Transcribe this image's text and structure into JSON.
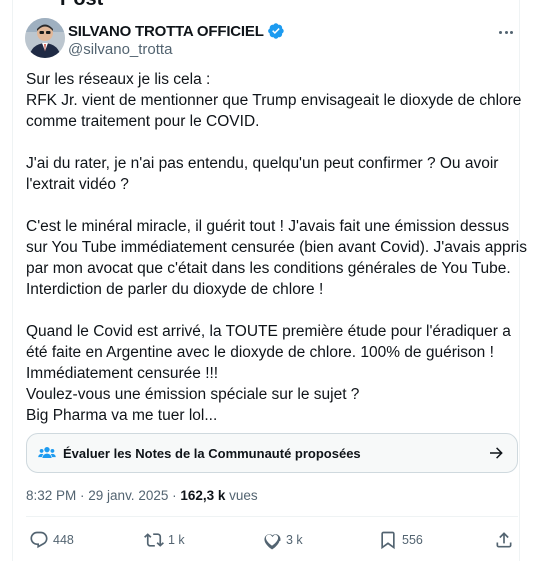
{
  "page": {
    "top_partial_title": "Post"
  },
  "author": {
    "display_name": "SILVANO TROTTA OFFICIEL",
    "handle": "@silvano_trotta",
    "verified_color": "#1d9bf0"
  },
  "tweet": {
    "lines": [
      "Sur les réseaux je lis cela :",
      "RFK Jr. vient de mentionner que Trump envisageait le dioxyde de chlore",
      "comme traitement pour le COVID.",
      "",
      "J'ai du rater, je n'ai pas entendu, quelqu'un peut confirmer ? Ou avoir",
      "l'extrait vidéo ?",
      "",
      "C'est le minéral miracle, il guérit tout ! J'avais fait une émission dessus",
      "sur You Tube immédiatement censurée (bien avant Covid). J'avais appris",
      "par mon avocat que c'était dans les conditions générales de You Tube.",
      "Interdiction de parler du dioxyde de chlore !",
      "",
      "Quand le Covid est arrivé, la TOUTE première étude pour l'éradiquer a",
      "été faite en Argentine avec le dioxyde de chlore. 100% de guérison !",
      "Immédiatement censurée !!!",
      "Voulez-vous une émission spéciale sur le sujet ?",
      "Big Pharma va me tuer lol..."
    ]
  },
  "community_notes": {
    "label": "Évaluer les Notes de la Communauté proposées",
    "icon": "people-icon",
    "accent": "#1d9bf0"
  },
  "meta": {
    "time": "8:32 PM",
    "separator": " · ",
    "date": "29 janv. 2025",
    "views_count": "162,3 k",
    "views_label": " vues"
  },
  "actions": {
    "replies": "448",
    "reposts": "1 k",
    "likes": "3 k",
    "bookmarks": "556"
  },
  "colors": {
    "text": "#0f1419",
    "secondary": "#536471",
    "border": "#cfd9de"
  }
}
